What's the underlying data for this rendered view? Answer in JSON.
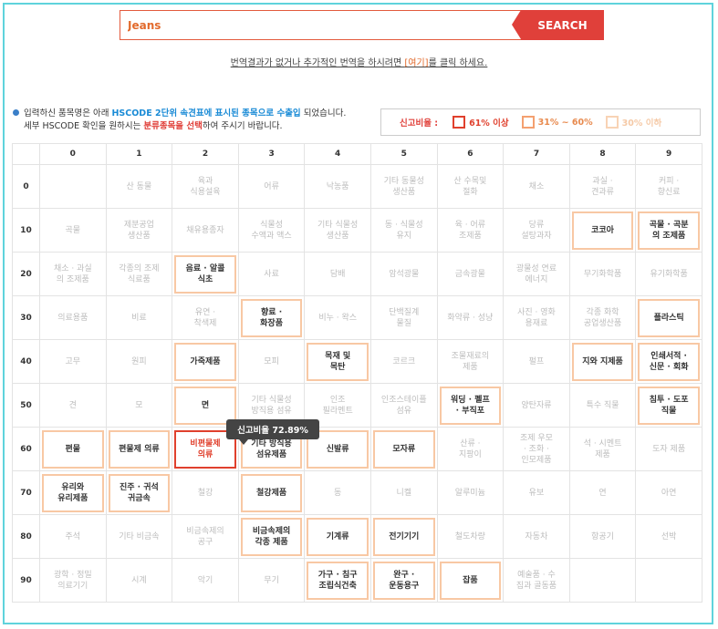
{
  "search": {
    "value": "Jeans",
    "button_label": "SEARCH"
  },
  "translation_note": {
    "before": "번역결과가 없거나 추가적인 번역을 하시려면 ",
    "link": "[여기]",
    "after": "를 클릭 하세요."
  },
  "info": {
    "line1_a": "입력하신 품목명은 아래 ",
    "line1_b": "HSCODE 2단위 속견표에 표시된 종목으로 수출입",
    "line1_c": " 되었습니다.",
    "line2_a": "세부 HSCODE 확인을 원하시는 ",
    "line2_b": "분류종목을 선택",
    "line2_c": "하여 주시기 바랍니다."
  },
  "legend": {
    "title": "신고비율 :",
    "items": [
      {
        "label": "61% 이상",
        "color": "#e0402d",
        "text_color": "#e0402d"
      },
      {
        "label": "31% ~ 60%",
        "color": "#f4a070",
        "text_color": "#e88a4e"
      },
      {
        "label": "30% 이하",
        "color": "#f8d3b5",
        "text_color": "#f5c9a6"
      }
    ]
  },
  "colors": {
    "frame": "#5fd3dc",
    "accent_red": "#e0403a",
    "mid_border": "#f8c8a4"
  },
  "tooltip": {
    "text": "신고비율 72.89%"
  },
  "grid": {
    "columns": [
      "0",
      "1",
      "2",
      "3",
      "4",
      "5",
      "6",
      "7",
      "8",
      "9"
    ],
    "rows": [
      {
        "head": "0",
        "cells": [
          {
            "t": "",
            "l": "low"
          },
          {
            "t": "산 동물",
            "l": "low"
          },
          {
            "t": "육과\n식용설육",
            "l": "low"
          },
          {
            "t": "어류",
            "l": "low"
          },
          {
            "t": "낙농품",
            "l": "low"
          },
          {
            "t": "기타 동물성\n생산품",
            "l": "low"
          },
          {
            "t": "산 수목및\n절화",
            "l": "low"
          },
          {
            "t": "채소",
            "l": "low"
          },
          {
            "t": "과실 ·\n견과류",
            "l": "low"
          },
          {
            "t": "커피 ·\n향신료",
            "l": "low"
          }
        ]
      },
      {
        "head": "10",
        "cells": [
          {
            "t": "곡물",
            "l": "low"
          },
          {
            "t": "제분공업\n생산품",
            "l": "low"
          },
          {
            "t": "채유용종자",
            "l": "low"
          },
          {
            "t": "식물성\n수액과 액스",
            "l": "low"
          },
          {
            "t": "기타 식물성\n생산품",
            "l": "low"
          },
          {
            "t": "동 · 식물성\n유지",
            "l": "low"
          },
          {
            "t": "육 · 어류\n조제품",
            "l": "low"
          },
          {
            "t": "당류\n설탕과자",
            "l": "low"
          },
          {
            "t": "코코아",
            "l": "mid"
          },
          {
            "t": "곡물 · 곡분\n의 조제품",
            "l": "mid"
          }
        ]
      },
      {
        "head": "20",
        "cells": [
          {
            "t": "채소 · 과실\n의 조제품",
            "l": "low"
          },
          {
            "t": "각종의 조제\n식료품",
            "l": "low"
          },
          {
            "t": "음료 · 알콜\n식초",
            "l": "mid"
          },
          {
            "t": "사료",
            "l": "low"
          },
          {
            "t": "담배",
            "l": "low"
          },
          {
            "t": "암석광물",
            "l": "low"
          },
          {
            "t": "금속광물",
            "l": "low"
          },
          {
            "t": "광물성 연료\n에너지",
            "l": "low"
          },
          {
            "t": "무기화학품",
            "l": "low"
          },
          {
            "t": "유기화학품",
            "l": "low"
          }
        ]
      },
      {
        "head": "30",
        "cells": [
          {
            "t": "의료용품",
            "l": "low"
          },
          {
            "t": "비료",
            "l": "low"
          },
          {
            "t": "유연 ·\n착색제",
            "l": "low"
          },
          {
            "t": "향료 ·\n화장품",
            "l": "mid"
          },
          {
            "t": "비누 · 왁스",
            "l": "low"
          },
          {
            "t": "단백질계\n물질",
            "l": "low"
          },
          {
            "t": "화약류 · 성냥",
            "l": "low"
          },
          {
            "t": "사진 · 영화\n용재료",
            "l": "low"
          },
          {
            "t": "각종 화학\n공업생산품",
            "l": "low"
          },
          {
            "t": "플라스틱",
            "l": "mid"
          }
        ]
      },
      {
        "head": "40",
        "cells": [
          {
            "t": "고무",
            "l": "low"
          },
          {
            "t": "원피",
            "l": "low"
          },
          {
            "t": "가죽제품",
            "l": "mid"
          },
          {
            "t": "모피",
            "l": "low"
          },
          {
            "t": "목재 및\n목탄",
            "l": "mid"
          },
          {
            "t": "코르크",
            "l": "low"
          },
          {
            "t": "조물재료의\n제품",
            "l": "low"
          },
          {
            "t": "펄프",
            "l": "low"
          },
          {
            "t": "지와 지제품",
            "l": "mid"
          },
          {
            "t": "인쇄서적 ·\n신문 · 회화",
            "l": "mid"
          }
        ]
      },
      {
        "head": "50",
        "cells": [
          {
            "t": "견",
            "l": "low"
          },
          {
            "t": "모",
            "l": "low"
          },
          {
            "t": "면",
            "l": "mid"
          },
          {
            "t": "기타 식물성\n방직용 섬유",
            "l": "low"
          },
          {
            "t": "인조\n필라멘트",
            "l": "low"
          },
          {
            "t": "인조스테이플\n섬유",
            "l": "low"
          },
          {
            "t": "워딩 · 펠프\n· 부직포",
            "l": "mid"
          },
          {
            "t": "양탄자류",
            "l": "low"
          },
          {
            "t": "특수 직물",
            "l": "low"
          },
          {
            "t": "침투 · 도포\n직물",
            "l": "mid"
          }
        ]
      },
      {
        "head": "60",
        "cells": [
          {
            "t": "편물",
            "l": "mid"
          },
          {
            "t": "편물제 의류",
            "l": "mid"
          },
          {
            "t": "비편물제\n의류",
            "l": "high"
          },
          {
            "t": "기타 방직용\n섬유제품",
            "l": "mid"
          },
          {
            "t": "신발류",
            "l": "mid"
          },
          {
            "t": "모자류",
            "l": "mid"
          },
          {
            "t": "산류 ·\n지팡이",
            "l": "low"
          },
          {
            "t": "조제 우모\n· 조화 ·\n인모제품",
            "l": "low"
          },
          {
            "t": "석 · 시멘트\n제품",
            "l": "low"
          },
          {
            "t": "도자 제품",
            "l": "low"
          }
        ]
      },
      {
        "head": "70",
        "cells": [
          {
            "t": "유리와\n유리제품",
            "l": "mid"
          },
          {
            "t": "진주 · 귀석\n귀금속",
            "l": "mid"
          },
          {
            "t": "철강",
            "l": "low"
          },
          {
            "t": "철강제품",
            "l": "mid"
          },
          {
            "t": "동",
            "l": "low"
          },
          {
            "t": "니켈",
            "l": "low"
          },
          {
            "t": "알루미늄",
            "l": "low"
          },
          {
            "t": "유보",
            "l": "low"
          },
          {
            "t": "연",
            "l": "low"
          },
          {
            "t": "아연",
            "l": "low"
          }
        ]
      },
      {
        "head": "80",
        "cells": [
          {
            "t": "주석",
            "l": "low"
          },
          {
            "t": "기타 비금속",
            "l": "low"
          },
          {
            "t": "비금속제의\n공구",
            "l": "low"
          },
          {
            "t": "비금속제의\n각종 제품",
            "l": "mid"
          },
          {
            "t": "기계류",
            "l": "mid"
          },
          {
            "t": "전기기기",
            "l": "mid"
          },
          {
            "t": "철도차량",
            "l": "low"
          },
          {
            "t": "자동차",
            "l": "low"
          },
          {
            "t": "항공기",
            "l": "low"
          },
          {
            "t": "선박",
            "l": "low"
          }
        ]
      },
      {
        "head": "90",
        "cells": [
          {
            "t": "광학 · 정밀\n의료기기",
            "l": "low"
          },
          {
            "t": "시계",
            "l": "low"
          },
          {
            "t": "악기",
            "l": "low"
          },
          {
            "t": "무기",
            "l": "low"
          },
          {
            "t": "가구 · 침구\n조립식건축",
            "l": "mid"
          },
          {
            "t": "완구 ·\n운동용구",
            "l": "mid"
          },
          {
            "t": "잡품",
            "l": "mid"
          },
          {
            "t": "예술품 · 수\n집과 골동품",
            "l": "low"
          },
          {
            "t": "",
            "l": "low"
          },
          {
            "t": "",
            "l": "low"
          }
        ]
      }
    ]
  }
}
